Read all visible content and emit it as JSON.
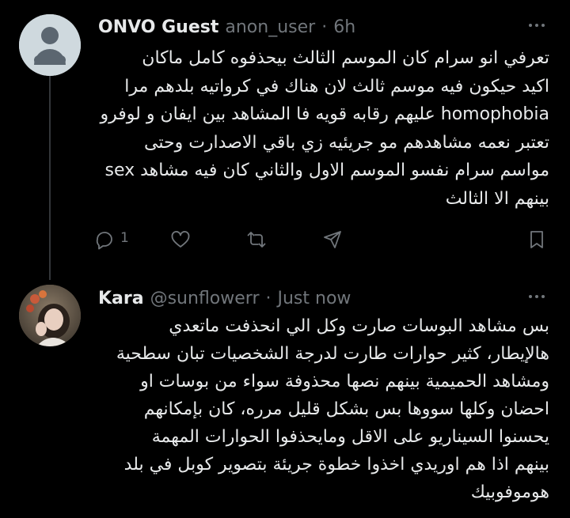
{
  "posts": [
    {
      "author_name": "ONVO Guest",
      "handle": "anon_user",
      "separator": "·",
      "time": "6h",
      "avatar_icon": "default-user-avatar-icon",
      "body_lines": [
        "تعرفي انو سرام كان الموسم الثالث بيحذفوه كامل ماكان",
        "اكيد حيكون فيه موسم ثالث لان هناك في كرواتيه بلدهم مرا",
        "homophobia عليهم رقابه قويه فا المشاهد بين ايفان و لوفرو",
        "تعتبر نعمه مشاهدهم مو جريئيه زي باقي الاصدارت وحتى",
        "مواسم سرام نفسو الموسم الاول والثاني كان فيه مشاهد sex",
        "بينهم الا الثالث"
      ],
      "reply_count": "1"
    },
    {
      "author_name": "Kara",
      "handle": "@sunflowerr",
      "separator": "·",
      "time": "Just now",
      "avatar_icon": "profile-photo-avatar",
      "body_lines": [
        "بس مشاهد البوسات صارت وكل الي انحذفت ماتعدي",
        "هالإيطار، كثير حوارات طارت لدرجة الشخصيات تبان سطحية",
        "ومشاهد الحميمية بينهم نصها محذوفة سواء من بوسات او",
        "احضان وكلها سووها بس بشكل قليل مرره، كان بإمكانهم",
        "يحسنوا السيناريو على الاقل ومايحذفوا الحوارات المهمة",
        "بينهم اذا هم اوريدي اخذوا خطوة جريئة بتصوير كوبل في بلد",
        "هوموفوبيك"
      ]
    }
  ],
  "icons": {
    "reply": "reply-bubble-icon",
    "like": "heart-icon",
    "retweet": "retweet-icon",
    "share": "share-icon",
    "bookmark": "bookmark-icon",
    "more": "more-options-icon"
  },
  "colors": {
    "background": "#000000",
    "primary_text": "#e7e9ea",
    "secondary_text": "#71767b",
    "thread_line": "#333639",
    "avatar_default": "#cfd9de"
  }
}
